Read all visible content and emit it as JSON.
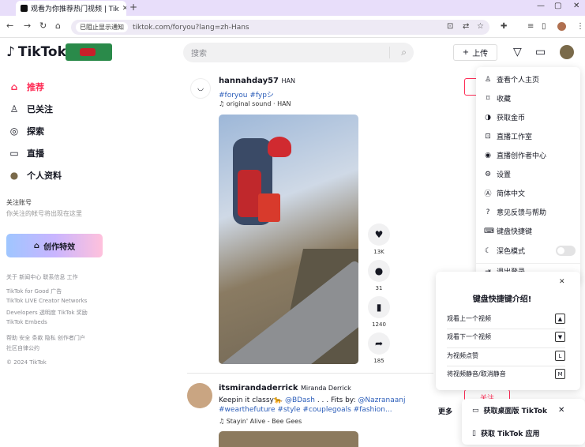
{
  "browser": {
    "tab_title": "观看为你推荐热门视频 | Tik",
    "omni_chip": "已阻止显示通知",
    "url": "tiktok.com/foryou?lang=zh-Hans"
  },
  "header": {
    "logo": "TikTok",
    "search_placeholder": "搜索",
    "upload_label": "上传"
  },
  "sidebar": {
    "items": [
      {
        "label": "推荐",
        "icon": "home-icon",
        "glyph": "⌂"
      },
      {
        "label": "已关注",
        "icon": "following-icon",
        "glyph": "♙"
      },
      {
        "label": "探索",
        "icon": "compass-icon",
        "glyph": "◎"
      },
      {
        "label": "直播",
        "icon": "live-icon",
        "glyph": "▭"
      },
      {
        "label": "个人资料",
        "icon": "avatar-icon",
        "glyph": "●"
      }
    ],
    "following_heading": "关注账号",
    "following_hint": "你关注的帐号将出现在这里",
    "effects_label": "创作特效",
    "footer": [
      "关于  新闻中心  联系信息  工作",
      "TikTok for Good  广告",
      "TikTok LIVE Creator Networks",
      "Developers  透明度  TikTok 奖励",
      "TikTok Embeds",
      "帮助  安全  条款  隐私  创作者门户",
      "社区自律公约",
      "© 2024 TikTok"
    ]
  },
  "posts": [
    {
      "username": "hannahday57",
      "nickname": "HAN",
      "tags": "#foryou #fypシ",
      "music": "♫ original sound · HAN",
      "likes": "13K",
      "comments": "31",
      "saves": "1240",
      "shares": "185"
    },
    {
      "username": "itsmirandaderrick",
      "nickname": "Miranda Derrick",
      "caption": "Keepin it classy🐆 ",
      "caption_mention": "@BDash",
      "caption_mid": " . . . Fits by: ",
      "caption_mention2": "@Nazranaanj",
      "tags": "#wearthefuture #style #couplegoals #fashion...",
      "music": "♫ Stayin' Alive - Bee Gees",
      "more": "更多",
      "follow": "关注"
    }
  ],
  "menu": {
    "items": [
      {
        "label": "查看个人主页",
        "icon": "user-icon",
        "glyph": "♙"
      },
      {
        "label": "收藏",
        "icon": "bookmark-icon",
        "glyph": "⌑"
      },
      {
        "label": "获取金币",
        "icon": "coin-icon",
        "glyph": "◑"
      },
      {
        "label": "直播工作室",
        "icon": "studio-icon",
        "glyph": "⊡"
      },
      {
        "label": "直播创作者中心",
        "icon": "creator-center-icon",
        "glyph": "◉"
      },
      {
        "label": "设置",
        "icon": "settings-icon",
        "glyph": "⚙"
      },
      {
        "label": "简体中文",
        "icon": "language-icon",
        "glyph": "Ⓐ"
      },
      {
        "label": "意见反馈与帮助",
        "icon": "help-icon",
        "glyph": "?"
      },
      {
        "label": "键盘快捷键",
        "icon": "keyboard-icon",
        "glyph": "⌨"
      },
      {
        "label": "深色模式",
        "icon": "moon-icon",
        "glyph": "☾"
      },
      {
        "label": "退出登录",
        "icon": "logout-icon",
        "glyph": "⇥"
      }
    ],
    "dark_mode_on": false
  },
  "shortcuts": {
    "title": "键盘快捷键介绍!",
    "rows": [
      {
        "label": "观看上一个视频",
        "key": "▲"
      },
      {
        "label": "观看下一个视频",
        "key": "▼"
      },
      {
        "label": "为视频点赞",
        "key": "L"
      },
      {
        "label": "将视频静音/取消静音",
        "key": "M"
      }
    ]
  },
  "get_app": {
    "desktop": "获取桌面版 TikTok",
    "app": "获取 TikTok 应用"
  }
}
